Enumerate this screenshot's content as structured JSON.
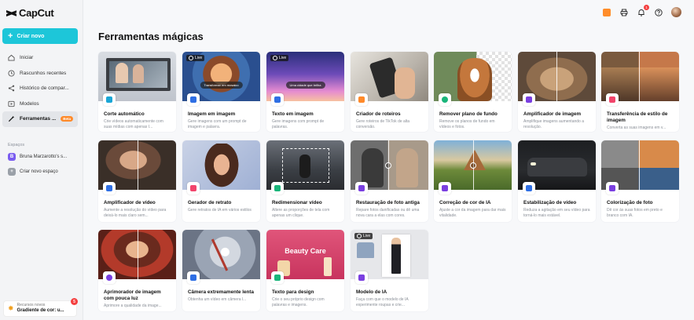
{
  "brand": {
    "name": "CapCut"
  },
  "sidebar": {
    "create_label": "Criar novo",
    "items": [
      {
        "label": "Iniciar",
        "icon": "home-icon"
      },
      {
        "label": "Rascunhos recentes",
        "icon": "clock-icon"
      },
      {
        "label": "Histórico de compar...",
        "icon": "share-icon"
      },
      {
        "label": "Modelos",
        "icon": "template-icon"
      },
      {
        "label": "Ferramentas ...",
        "icon": "magic-tools-icon",
        "active": true,
        "badge": "Beta"
      }
    ],
    "spaces_label": "Espaços",
    "space_name": "Bruna Marzarotto's s...",
    "space_initial": "B",
    "new_space_label": "Criar novo espaço",
    "promo": {
      "small": "Recursos novos",
      "big": "Gradiente de cor: u...",
      "count": "5"
    }
  },
  "topbar": {
    "notification_count": "1"
  },
  "page": {
    "title": "Ferramentas mágicas"
  },
  "cards": [
    {
      "title": "Corte automático",
      "desc": "Crie vídeos automaticamente com suas mídias com apenas I...",
      "icon_color": "#1aa6d6"
    },
    {
      "title": "Imagem em imagem",
      "desc": "Gere imagens com um prompt de imagem e palavra.",
      "icon_color": "#2f6fe4",
      "live": "Live",
      "prompt": "Transformar em mosaico"
    },
    {
      "title": "Texto em imagem",
      "desc": "Gere imagens com prompt de palavras.",
      "icon_color": "#2f6fe4",
      "live": "Live",
      "prompt": "Uma cidade que brilha"
    },
    {
      "title": "Criador de roteiros",
      "desc": "Gere roteiros de TikTok de alta conversão.",
      "icon_color": "#ff8a2a"
    },
    {
      "title": "Remover plano de fundo",
      "desc": "Remove os planos de fundo em vídeos e fotos.",
      "icon_color": "#19b57a"
    },
    {
      "title": "Amplificador de imagem",
      "desc": "Amplifique imagens aumentando a resolução.",
      "icon_color": "#7a3fe0"
    },
    {
      "title": "Transferência de estilo de imagem",
      "desc": "Converta as suas imagens em v...",
      "icon_color": "#f2456b"
    },
    {
      "title": "Amplificador de vídeo",
      "desc": "Aumente a resolução do vídeo para deixá-lo mais claro sem...",
      "icon_color": "#2f6fe4"
    },
    {
      "title": "Gerador de retrato",
      "desc": "Gere retratos de IA em vários estilos",
      "icon_color": "#f2456b"
    },
    {
      "title": "Redimensionar vídeo",
      "desc": "Altere as proporções de tela com apenas um clique.",
      "icon_color": "#19b57a"
    },
    {
      "title": "Restauração de foto antiga",
      "desc": "Repare fotos danificadas ou dê uma nova cara a elas com cores.",
      "icon_color": "#7a3fe0"
    },
    {
      "title": "Correção de cor de IA",
      "desc": "Ajuste a cor da imagem para dar mais vitalidade.",
      "icon_color": "#7a3fe0"
    },
    {
      "title": "Estabilização de vídeo",
      "desc": "Reduza a agitação em seu vídeo para torná-lo mais estável.",
      "icon_color": "#2f6fe4"
    },
    {
      "title": "Colorização de foto",
      "desc": "Dê cor às suas fotos em preto e branco com IA.",
      "icon_color": "#7a3fe0"
    },
    {
      "title": "Aprimorador de imagem com pouca luz",
      "desc": "Aprimore a qualidade da image...",
      "icon_color": "#7a3fe0"
    },
    {
      "title": "Câmera extremamente lenta",
      "desc": "Obtenha um vídeo em câmera l...",
      "icon_color": "#2f6fe4"
    },
    {
      "title": "Texto para design",
      "desc": "Crie o seu próprio design com palavras e imagens.",
      "icon_color": "#19b57a",
      "overlay": "Beauty Care"
    },
    {
      "title": "Modelo de IA",
      "desc": "Faça com que o modelo de IA experimente roupas e crie...",
      "icon_color": "#7a3fe0",
      "live": "Live"
    }
  ]
}
